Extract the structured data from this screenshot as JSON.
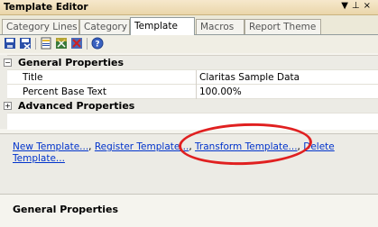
{
  "window": {
    "title": "Template Editor"
  },
  "tabs": [
    {
      "label": "Category Lines"
    },
    {
      "label": "Category"
    },
    {
      "label": "Template",
      "active": true
    },
    {
      "label": "Macros"
    },
    {
      "label": "Report Theme"
    }
  ],
  "toolbar": {
    "buttons": [
      "save-icon",
      "save-as-icon",
      "new-document-icon",
      "export-icon",
      "delete-icon",
      "help-icon"
    ]
  },
  "properties": {
    "general_header": "General Properties",
    "rows": [
      {
        "name": "Title",
        "value": "Claritas Sample Data"
      },
      {
        "name": "Percent Base Text",
        "value": "100.00%"
      }
    ],
    "advanced_header": "Advanced Properties"
  },
  "commands": {
    "new_template": "New Template...",
    "register_template": "Register Template...",
    "transform_template": "Transform Template...",
    "delete_template_part1": "Delete",
    "delete_template_part2": "Template...",
    "separator": ","
  },
  "description": {
    "title": "General Properties"
  },
  "colors": {
    "link": "#0033cc",
    "highlight_oval": "#e02020",
    "titlebar": "#f0e0b8"
  }
}
